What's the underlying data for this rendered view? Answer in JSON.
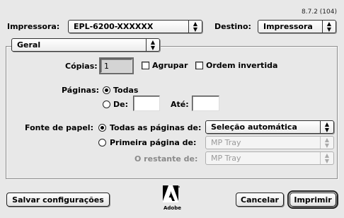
{
  "window": {
    "version": "8.7.2 (104)"
  },
  "printer": {
    "label": "Impressora:",
    "value": "EPL-6200-XXXXXX"
  },
  "destination": {
    "label": "Destino:",
    "value": "Impressora"
  },
  "panel": {
    "value": "Geral"
  },
  "copies": {
    "label": "Cópias:",
    "value": "1",
    "collate_label": "Agrupar",
    "collate_checked": false,
    "reverse_label": "Ordem invertida",
    "reverse_checked": false
  },
  "pages": {
    "label": "Páginas:",
    "all_label": "Todas",
    "all_selected": true,
    "from_label": "De:",
    "from_value": "",
    "to_label": "Até:",
    "to_value": ""
  },
  "paper_source": {
    "label": "Fonte de papel:",
    "all_pages_label": "Todas as páginas de:",
    "all_pages_selected": true,
    "all_pages_value": "Seleção automática",
    "first_page_label": "Primeira página de:",
    "first_page_value": "MP Tray",
    "remaining_label": "O restante de:",
    "remaining_value": "MP Tray"
  },
  "buttons": {
    "save": "Salvar configurações",
    "cancel": "Cancelar",
    "print": "Imprimir"
  },
  "logo": {
    "text": "Adobe"
  }
}
